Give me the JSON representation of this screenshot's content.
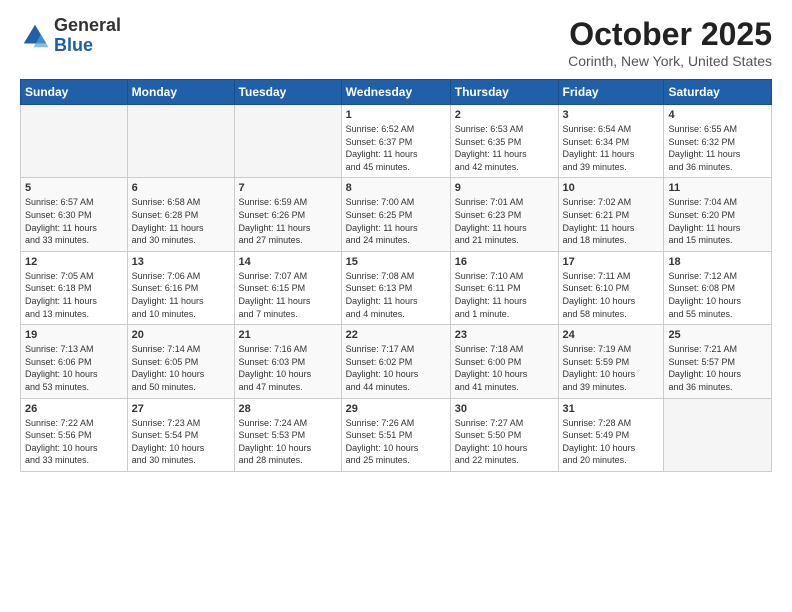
{
  "logo": {
    "general": "General",
    "blue": "Blue"
  },
  "header": {
    "month": "October 2025",
    "location": "Corinth, New York, United States"
  },
  "weekdays": [
    "Sunday",
    "Monday",
    "Tuesday",
    "Wednesday",
    "Thursday",
    "Friday",
    "Saturday"
  ],
  "weeks": [
    [
      {
        "day": "",
        "info": ""
      },
      {
        "day": "",
        "info": ""
      },
      {
        "day": "",
        "info": ""
      },
      {
        "day": "1",
        "info": "Sunrise: 6:52 AM\nSunset: 6:37 PM\nDaylight: 11 hours\nand 45 minutes."
      },
      {
        "day": "2",
        "info": "Sunrise: 6:53 AM\nSunset: 6:35 PM\nDaylight: 11 hours\nand 42 minutes."
      },
      {
        "day": "3",
        "info": "Sunrise: 6:54 AM\nSunset: 6:34 PM\nDaylight: 11 hours\nand 39 minutes."
      },
      {
        "day": "4",
        "info": "Sunrise: 6:55 AM\nSunset: 6:32 PM\nDaylight: 11 hours\nand 36 minutes."
      }
    ],
    [
      {
        "day": "5",
        "info": "Sunrise: 6:57 AM\nSunset: 6:30 PM\nDaylight: 11 hours\nand 33 minutes."
      },
      {
        "day": "6",
        "info": "Sunrise: 6:58 AM\nSunset: 6:28 PM\nDaylight: 11 hours\nand 30 minutes."
      },
      {
        "day": "7",
        "info": "Sunrise: 6:59 AM\nSunset: 6:26 PM\nDaylight: 11 hours\nand 27 minutes."
      },
      {
        "day": "8",
        "info": "Sunrise: 7:00 AM\nSunset: 6:25 PM\nDaylight: 11 hours\nand 24 minutes."
      },
      {
        "day": "9",
        "info": "Sunrise: 7:01 AM\nSunset: 6:23 PM\nDaylight: 11 hours\nand 21 minutes."
      },
      {
        "day": "10",
        "info": "Sunrise: 7:02 AM\nSunset: 6:21 PM\nDaylight: 11 hours\nand 18 minutes."
      },
      {
        "day": "11",
        "info": "Sunrise: 7:04 AM\nSunset: 6:20 PM\nDaylight: 11 hours\nand 15 minutes."
      }
    ],
    [
      {
        "day": "12",
        "info": "Sunrise: 7:05 AM\nSunset: 6:18 PM\nDaylight: 11 hours\nand 13 minutes."
      },
      {
        "day": "13",
        "info": "Sunrise: 7:06 AM\nSunset: 6:16 PM\nDaylight: 11 hours\nand 10 minutes."
      },
      {
        "day": "14",
        "info": "Sunrise: 7:07 AM\nSunset: 6:15 PM\nDaylight: 11 hours\nand 7 minutes."
      },
      {
        "day": "15",
        "info": "Sunrise: 7:08 AM\nSunset: 6:13 PM\nDaylight: 11 hours\nand 4 minutes."
      },
      {
        "day": "16",
        "info": "Sunrise: 7:10 AM\nSunset: 6:11 PM\nDaylight: 11 hours\nand 1 minute."
      },
      {
        "day": "17",
        "info": "Sunrise: 7:11 AM\nSunset: 6:10 PM\nDaylight: 10 hours\nand 58 minutes."
      },
      {
        "day": "18",
        "info": "Sunrise: 7:12 AM\nSunset: 6:08 PM\nDaylight: 10 hours\nand 55 minutes."
      }
    ],
    [
      {
        "day": "19",
        "info": "Sunrise: 7:13 AM\nSunset: 6:06 PM\nDaylight: 10 hours\nand 53 minutes."
      },
      {
        "day": "20",
        "info": "Sunrise: 7:14 AM\nSunset: 6:05 PM\nDaylight: 10 hours\nand 50 minutes."
      },
      {
        "day": "21",
        "info": "Sunrise: 7:16 AM\nSunset: 6:03 PM\nDaylight: 10 hours\nand 47 minutes."
      },
      {
        "day": "22",
        "info": "Sunrise: 7:17 AM\nSunset: 6:02 PM\nDaylight: 10 hours\nand 44 minutes."
      },
      {
        "day": "23",
        "info": "Sunrise: 7:18 AM\nSunset: 6:00 PM\nDaylight: 10 hours\nand 41 minutes."
      },
      {
        "day": "24",
        "info": "Sunrise: 7:19 AM\nSunset: 5:59 PM\nDaylight: 10 hours\nand 39 minutes."
      },
      {
        "day": "25",
        "info": "Sunrise: 7:21 AM\nSunset: 5:57 PM\nDaylight: 10 hours\nand 36 minutes."
      }
    ],
    [
      {
        "day": "26",
        "info": "Sunrise: 7:22 AM\nSunset: 5:56 PM\nDaylight: 10 hours\nand 33 minutes."
      },
      {
        "day": "27",
        "info": "Sunrise: 7:23 AM\nSunset: 5:54 PM\nDaylight: 10 hours\nand 30 minutes."
      },
      {
        "day": "28",
        "info": "Sunrise: 7:24 AM\nSunset: 5:53 PM\nDaylight: 10 hours\nand 28 minutes."
      },
      {
        "day": "29",
        "info": "Sunrise: 7:26 AM\nSunset: 5:51 PM\nDaylight: 10 hours\nand 25 minutes."
      },
      {
        "day": "30",
        "info": "Sunrise: 7:27 AM\nSunset: 5:50 PM\nDaylight: 10 hours\nand 22 minutes."
      },
      {
        "day": "31",
        "info": "Sunrise: 7:28 AM\nSunset: 5:49 PM\nDaylight: 10 hours\nand 20 minutes."
      },
      {
        "day": "",
        "info": ""
      }
    ]
  ]
}
